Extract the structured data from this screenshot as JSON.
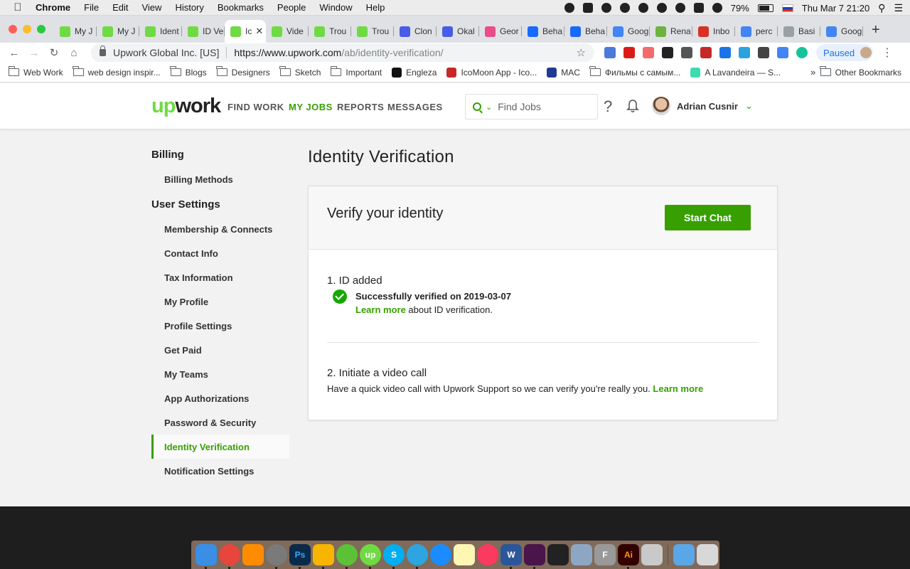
{
  "menubar": {
    "items": [
      "Chrome",
      "File",
      "Edit",
      "View",
      "History",
      "Bookmarks",
      "People",
      "Window",
      "Help"
    ],
    "battery": "79%",
    "clock": "Thu Mar 7  21:20"
  },
  "tabs": [
    {
      "label": "My J",
      "favicon": "upwork-icon",
      "color": "#6fda44"
    },
    {
      "label": "My J",
      "favicon": "upwork-icon",
      "color": "#6fda44"
    },
    {
      "label": "Ident",
      "favicon": "upwork-icon",
      "color": "#6fda44"
    },
    {
      "label": "ID Ve",
      "favicon": "upwork-icon",
      "color": "#6fda44"
    },
    {
      "label": "Ic",
      "favicon": "upwork-icon",
      "color": "#6fda44",
      "active": true
    },
    {
      "label": "Vide",
      "favicon": "upwork-icon",
      "color": "#6fda44"
    },
    {
      "label": "Trou",
      "favicon": "upwork-icon",
      "color": "#6fda44"
    },
    {
      "label": "Trou",
      "favicon": "upwork-icon",
      "color": "#6fda44"
    },
    {
      "label": "Clon",
      "favicon": "w-icon",
      "color": "#4a5be6"
    },
    {
      "label": "Okal",
      "favicon": "w-icon",
      "color": "#4a5be6"
    },
    {
      "label": "Geor",
      "favicon": "dribbble-icon",
      "color": "#ea4c89"
    },
    {
      "label": "Beha",
      "favicon": "behance-icon",
      "color": "#1769ff"
    },
    {
      "label": "Beha",
      "favicon": "behance-icon",
      "color": "#1769ff"
    },
    {
      "label": "Goog",
      "favicon": "translate-icon",
      "color": "#4285f4"
    },
    {
      "label": "Rena",
      "favicon": "leaf-icon",
      "color": "#6db33f"
    },
    {
      "label": "Inbo",
      "favicon": "gmail-icon",
      "color": "#d93025"
    },
    {
      "label": "perc",
      "favicon": "google-icon",
      "color": "#4285f4"
    },
    {
      "label": "Basi",
      "favicon": "page-icon",
      "color": "#9aa0a6"
    },
    {
      "label": "Goog",
      "favicon": "translate-icon",
      "color": "#4285f4"
    }
  ],
  "omnibox": {
    "org": "Upwork Global Inc. [US]",
    "url_host": "https://www.upwork.com",
    "url_path": "/ab/identity-verification/"
  },
  "profile_status": "Paused",
  "bookmarks": [
    "Web Work",
    "web design inspir...",
    "Blogs",
    "Designers",
    "Sketch",
    "Important",
    "Engleza",
    "IcoMoon App - Ico...",
    "MAC",
    "Фильмы с самым...",
    "A Lavandeira — S..."
  ],
  "bookmarks_more": "»",
  "bookmarks_other": "Other Bookmarks",
  "header": {
    "logo_up": "up",
    "logo_work": "work",
    "nav": [
      "FIND WORK",
      "MY JOBS",
      "REPORTS",
      "MESSAGES"
    ],
    "search_placeholder": "Find Jobs",
    "help": "?",
    "user_name": "Adrian Cusnir"
  },
  "sidebar": {
    "billing_heading": "Billing",
    "billing_items": [
      "Billing Methods"
    ],
    "user_heading": "User Settings",
    "user_items": [
      "Membership & Connects",
      "Contact Info",
      "Tax Information",
      "My Profile",
      "Profile Settings",
      "Get Paid",
      "My Teams",
      "App Authorizations",
      "Password & Security",
      "Identity Verification",
      "Notification Settings"
    ],
    "active_item": "Identity Verification"
  },
  "page": {
    "title": "Identity Verification",
    "card_title": "Verify your identity",
    "start_chat": "Start Chat",
    "step1_heading": "1. ID added",
    "step1_status": "Successfully verified on 2019-03-07",
    "step1_link": "Learn more",
    "step1_suffix": " about ID verification.",
    "step2_heading": "2. Initiate a video call",
    "step2_text": "Have a quick video call with Upwork Support so we can verify you're really you. ",
    "step2_link": "Learn more"
  },
  "colors": {
    "brand_green": "#37a000",
    "logo_green": "#6fda44",
    "check_green": "#14a800"
  }
}
